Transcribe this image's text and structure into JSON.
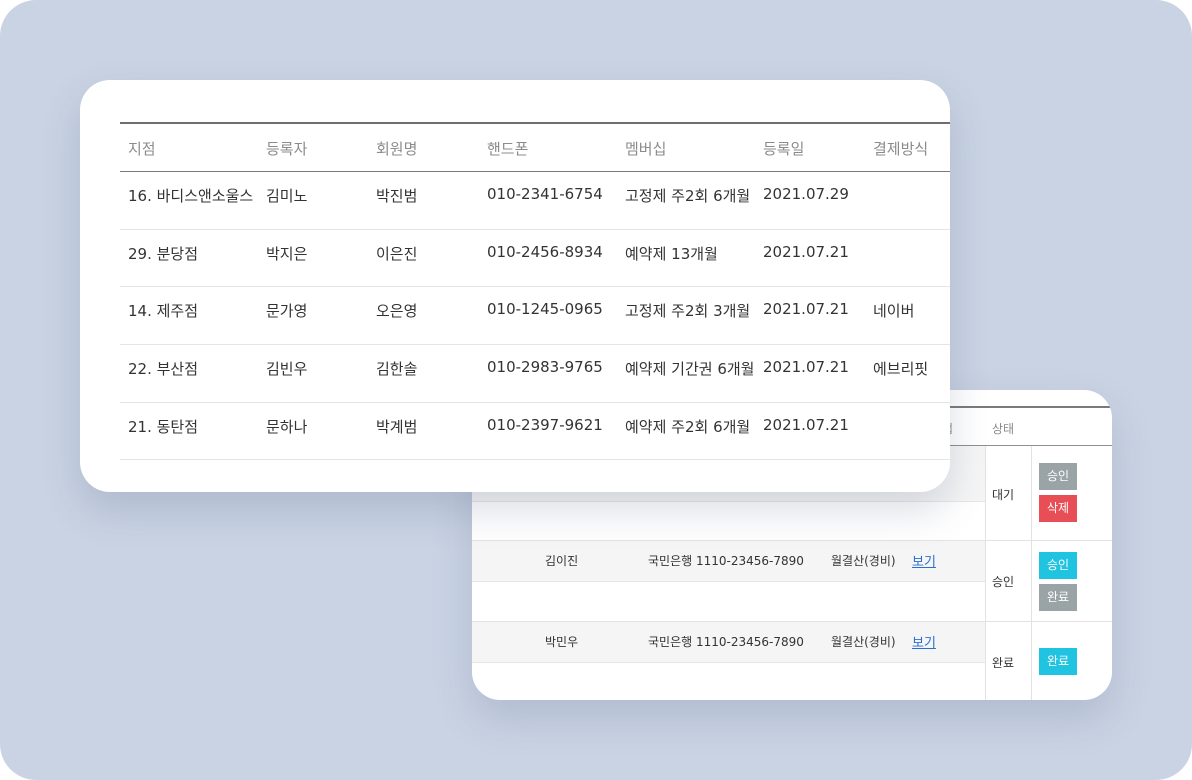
{
  "main_table": {
    "columns": [
      "지점",
      "등록자",
      "회원명",
      "핸드폰",
      "멤버십",
      "등록일",
      "결제방식"
    ],
    "rows": [
      [
        "16. 바디스앤소울스",
        "김미노",
        "박진범",
        "010-2341-6754",
        "고정제 주2회 6개월",
        "2021.07.29",
        ""
      ],
      [
        "29. 분당점",
        "박지은",
        "이은진",
        "010-2456-8934",
        "예약제 13개월",
        "2021.07.21",
        ""
      ],
      [
        "14. 제주점",
        "문가영",
        "오은영",
        "010-1245-0965",
        "고정제 주2회 3개월",
        "2021.07.21",
        "네이버"
      ],
      [
        "22. 부산점",
        "김빈우",
        "김한솔",
        "010-2983-9765",
        "예약제 기간권 6개월",
        "2021.07.21",
        "에브리핏"
      ],
      [
        "21. 동탄점",
        "문하나",
        "박계범",
        "010-2397-9621",
        "예약제 주2회 6개월",
        "2021.07.21",
        ""
      ]
    ]
  },
  "approval_table": {
    "headers": [
      "법",
      "상태"
    ],
    "rows": [
      {
        "name": "",
        "account": "",
        "billing": "",
        "link": "",
        "status": "대기",
        "buttons": [
          "승인",
          "삭제"
        ]
      },
      {
        "name": "김이진",
        "account": "국민은행 1110-23456-7890",
        "billing": "월결산(경비)",
        "link": "보기",
        "status": "승인",
        "buttons": [
          "승인",
          "완료"
        ]
      },
      {
        "name": "박민우",
        "account": "국민은행 1110-23456-7890",
        "billing": "월결산(경비)",
        "link": "보기",
        "status": "완료",
        "buttons": [
          "완료"
        ]
      }
    ]
  },
  "colors": {
    "background": "#c9d3e3",
    "approve": "#9aa4a7",
    "delete": "#e84e55",
    "done": "#21c4e0",
    "link": "#2a6fcf"
  }
}
